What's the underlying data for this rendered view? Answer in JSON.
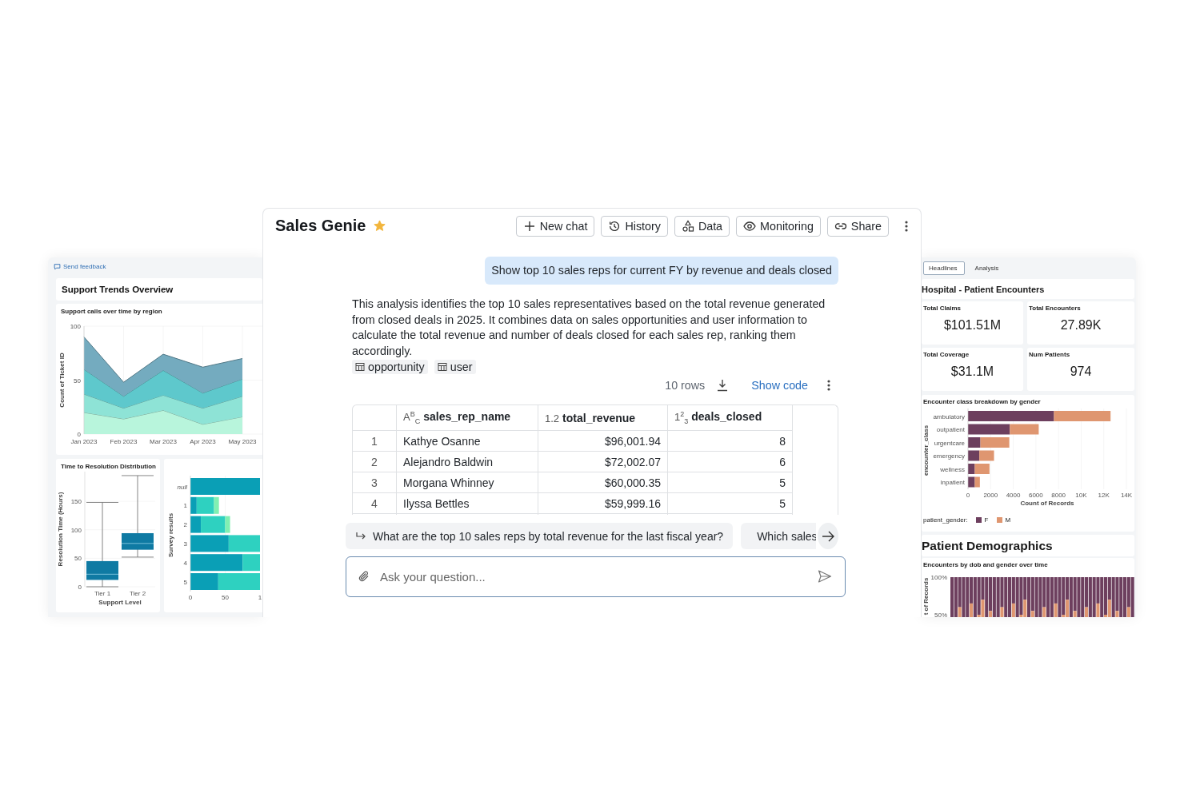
{
  "support_dashboard": {
    "feedback_link": "Send feedback",
    "title": "Support Trends Overview",
    "calls_chart": {
      "title": "Support calls over time by region",
      "chart_data": {
        "type": "area",
        "ylabel": "Count of Ticket ID",
        "categories": [
          "Jan 2023",
          "Feb 2023",
          "Mar 2023",
          "Apr 2023",
          "May 2023"
        ],
        "stacked": true,
        "grid": true,
        "ylim": [
          0,
          100
        ],
        "yticks": [
          0,
          50,
          100
        ],
        "series": [
          {
            "color": "#b8f5dc",
            "values": [
              20,
              14,
              22,
              9,
              16
            ]
          },
          {
            "color": "#8ee3d6",
            "values": [
              17,
              10,
              14,
              15,
              19
            ]
          },
          {
            "color": "#5ec8cc",
            "values": [
              23,
              11,
              23,
              14,
              16
            ]
          },
          {
            "color": "#74abbf",
            "values": [
              30,
              13,
              15,
              24,
              19
            ]
          }
        ]
      }
    },
    "resolution_chart": {
      "title": "Time to Resolution Distribution",
      "ylabel": "Resolution Time (Hours)",
      "xlabel": "Support Level",
      "categories": [
        "Tier 1",
        "Tier 2"
      ],
      "yticks": [
        "150",
        "100",
        "50",
        "0"
      ]
    },
    "survey_chart": {
      "chart_data": {
        "type": "bar",
        "orientation": "horizontal",
        "stacked": true,
        "grid": true,
        "ylabel": "Survey results",
        "categories": [
          "null",
          "1",
          "2",
          "3",
          "4",
          "5"
        ],
        "xlim": [
          0,
          100
        ],
        "xticks": [
          0,
          50
        ],
        "series": [
          {
            "color": "#0a9fb6",
            "values": [
              100,
              9,
              15,
              55,
              75,
              40
            ]
          },
          {
            "color": "#2ed1c0",
            "values": [
              0,
              25,
              35,
              45,
              25,
              60
            ]
          },
          {
            "color": "#80f0b2",
            "values": [
              0,
              7,
              7,
              0,
              0,
              0
            ]
          }
        ]
      },
      "cut_tick_label": "1"
    }
  },
  "chat": {
    "title": "Sales Genie",
    "favorite": true,
    "toolbar": [
      "New chat",
      "History",
      "Data",
      "Monitoring",
      "Share"
    ],
    "user_message": "Show top 10 sales reps for current FY by revenue and deals closed",
    "response": {
      "text": "This analysis identifies the top 10 sales representatives based on the total revenue generated from closed deals in 2025. It combines data on sales opportunities and user information to calculate the total revenue and number of deals closed for each sales rep, ranking them accordingly.",
      "sources": [
        "opportunity",
        "user"
      ]
    },
    "result": {
      "row_count": "10 rows",
      "show_code": "Show code",
      "columns": [
        {
          "type_label": "A$^{B}$$_{C}$",
          "name": "sales_rep_name"
        },
        {
          "type_label": "1.2",
          "name": "total_revenue"
        },
        {
          "type_label": "1$^{2}$$_{3}$",
          "name": "deals_closed"
        }
      ],
      "rows": [
        {
          "index": "1",
          "cells": [
            "Kathye Osanne",
            "$96,001.94",
            "8"
          ]
        },
        {
          "index": "2",
          "cells": [
            "Alejandro Baldwin",
            "$72,002.07",
            "6"
          ]
        },
        {
          "index": "3",
          "cells": [
            "Morgana Whinney",
            "$60,000.35",
            "5"
          ]
        },
        {
          "index": "4",
          "cells": [
            "Ilyssa Bettles",
            "$59,999.16",
            "5"
          ]
        }
      ]
    },
    "suggestions": [
      "What are the top 10 sales reps by total revenue for the last fiscal year?",
      "Which sales"
    ],
    "input": {
      "placeholder": "Ask your question..."
    }
  },
  "hospital_dashboard": {
    "tabs": [
      {
        "label": "Headlines",
        "selected": true
      },
      {
        "label": "Analysis",
        "selected": false
      }
    ],
    "title": "Hospital - Patient Encounters",
    "kpis": [
      {
        "label": "Total Claims",
        "value": "$101.51M"
      },
      {
        "label": "Total Encounters",
        "value": "27.89K"
      },
      {
        "label": "Total Coverage",
        "value": "$31.1M"
      },
      {
        "label": "Num Patients",
        "value": "974"
      }
    ],
    "encounter_chart": {
      "title": "Encounter class breakdown by gender",
      "legend_title": "patient_gender:",
      "chart_data": {
        "type": "bar",
        "orientation": "horizontal",
        "stacked": true,
        "grid": true,
        "xlabel": "Count of Records",
        "ylabel": "encounter_class",
        "categories": [
          "ambulatory",
          "outpatient",
          "urgentcare",
          "emergency",
          "wellness",
          "inpatient"
        ],
        "xlim": [
          0,
          14000
        ],
        "xticks": [
          0,
          2000,
          4000,
          6000,
          8000,
          {
            "value": 10000,
            "label": "10K"
          },
          {
            "value": 12000,
            "label": "12K"
          },
          {
            "value": 14000,
            "label": "14K"
          }
        ],
        "series": [
          {
            "name": "F",
            "color": "#6d3f5e",
            "values": [
              7600,
              3700,
              1100,
              1000,
              600,
              600
            ]
          },
          {
            "name": "M",
            "color": "#df9670",
            "values": [
              5000,
              2550,
              2550,
              1300,
              1300,
              450
            ]
          }
        ]
      }
    },
    "demographics": {
      "heading": "Patient Demographics",
      "chart_title": "Encounters by dob and gender over time",
      "ylabel": "t of Records",
      "yticks": [
        "100%",
        "50%"
      ]
    }
  }
}
